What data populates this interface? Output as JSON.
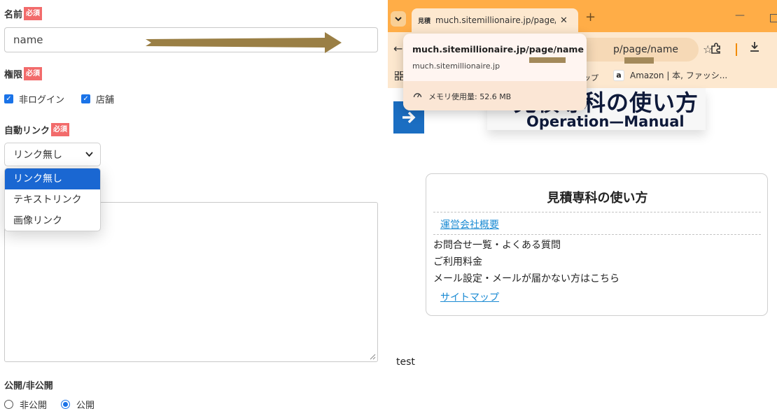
{
  "form": {
    "name_field": {
      "label": "名前",
      "required_badge": "必須",
      "value": "name"
    },
    "permission": {
      "label": "権限",
      "required_badge": "必須",
      "options": [
        {
          "label": "非ログイン",
          "checked": true
        },
        {
          "label": "店舗",
          "checked": true
        }
      ]
    },
    "auto_link": {
      "label": "自動リンク",
      "required_badge": "必須",
      "selected": "リンク無し",
      "options": [
        "リンク無し",
        "テキストリンク",
        "画像リンク"
      ]
    },
    "visibility": {
      "label": "公開/非公開",
      "options": [
        {
          "label": "非公開",
          "selected": false
        },
        {
          "label": "公開",
          "selected": true
        }
      ]
    }
  },
  "browser": {
    "tab": {
      "favicon": "見積",
      "title": "much.sitemillionaire.jp/page/na"
    },
    "new_tab": "+",
    "window_minimize": "—",
    "omnibox_text": "p/page/name",
    "bookmarks": {
      "item1": "マップ",
      "item2": "Amazon | 本, ファッシ..."
    },
    "hover_card": {
      "title": "much.sitemillionaire.jp/page/name",
      "domain": "much.sitemillionaire.jp",
      "memory": "メモリ使用量: 52.6 MB"
    }
  },
  "page": {
    "banner_jp": "見積専科の使い方",
    "banner_en": "Operation—Manual",
    "infobox": {
      "title": "見積専科の使い方",
      "link_company": "運営会社概要",
      "item_contact": "お問合せ一覧・よくある質問",
      "item_pricing": "ご利用料金",
      "item_mail": "メール設定・メールが届かない方はこちら",
      "link_sitemap": "サイトマップ"
    },
    "footer_text": "test"
  },
  "colors": {
    "required_badge": "#f26b6b",
    "tab_strip": "#ffad47",
    "toolbar": "#fde8cf",
    "link": "#1a8ad3",
    "dropdown_selected": "#1a67d2",
    "annotation_arrow": "#9a7f45"
  }
}
